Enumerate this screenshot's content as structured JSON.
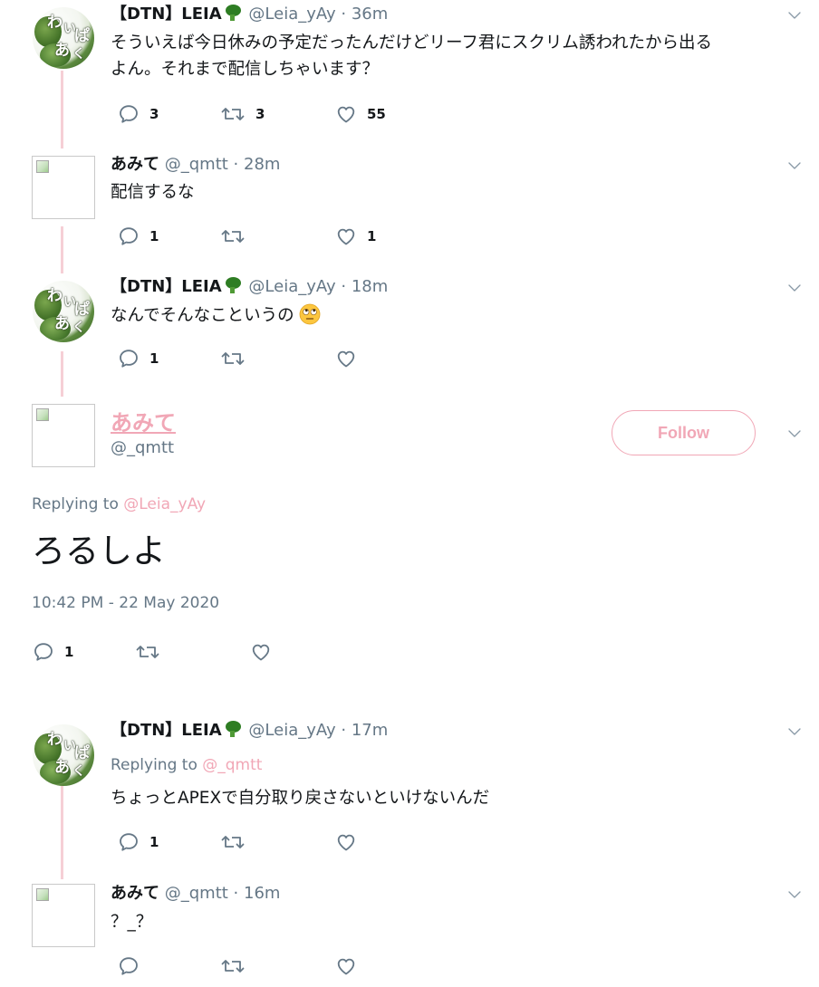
{
  "tweets": [
    {
      "name": "【DTN】LEIA",
      "handle": "@Leia_yAy",
      "time": "· 36m",
      "text_lines": [
        "そういえば今日休みの予定だったんだけどリーフ君にスクリム誘われたから出る",
        "よん。それまで配信しちゃいます？"
      ],
      "replies": "3",
      "retweets": "3",
      "likes": "55",
      "avatar_text": [
        "わ",
        "い",
        "ぱ",
        "あ",
        "く"
      ]
    },
    {
      "name": "あみて",
      "handle": "@_qmtt",
      "time": "· 28m",
      "text_lines": [
        "配信するな"
      ],
      "replies": "1",
      "retweets": "",
      "likes": "1"
    },
    {
      "name": "【DTN】LEIA",
      "handle": "@Leia_yAy",
      "time": "· 18m",
      "text_lines": [
        "なんでそんなこというの"
      ],
      "replies": "1",
      "retweets": "",
      "likes": ""
    }
  ],
  "main_tweet": {
    "name": "あみて",
    "handle": "@_qmtt",
    "follow_label": "Follow",
    "replying_prefix": "Replying to",
    "replying_to": "@Leia_yAy",
    "text": "ろるしよ",
    "timestamp": "10:42 PM - 22 May 2020",
    "replies": "1",
    "retweets": "",
    "likes": ""
  },
  "replies_below": [
    {
      "name": "【DTN】LEIA",
      "handle": "@Leia_yAy",
      "time": "· 17m",
      "replying_prefix": "Replying to",
      "replying_to": "@_qmtt",
      "text_lines": [
        "ちょっとAPEXで自分取り戻さないといけないんだ"
      ],
      "replies": "1",
      "retweets": "",
      "likes": ""
    },
    {
      "name": "あみて",
      "handle": "@_qmtt",
      "time": "· 16m",
      "text_lines": [
        "？_？"
      ],
      "replies": "",
      "retweets": "",
      "likes": ""
    }
  ],
  "icons": {
    "reply": "reply-icon",
    "retweet": "retweet-icon",
    "like": "heart-icon",
    "caret": "chevron-down-icon",
    "emoji": "rolling-eyes-emoji-icon",
    "badge": "broccoli-icon"
  },
  "colors": {
    "accent": "#f1a7b6",
    "thread_line": "#f6cfd6",
    "secondary_text": "#657786",
    "icon_gray": "#657786"
  }
}
